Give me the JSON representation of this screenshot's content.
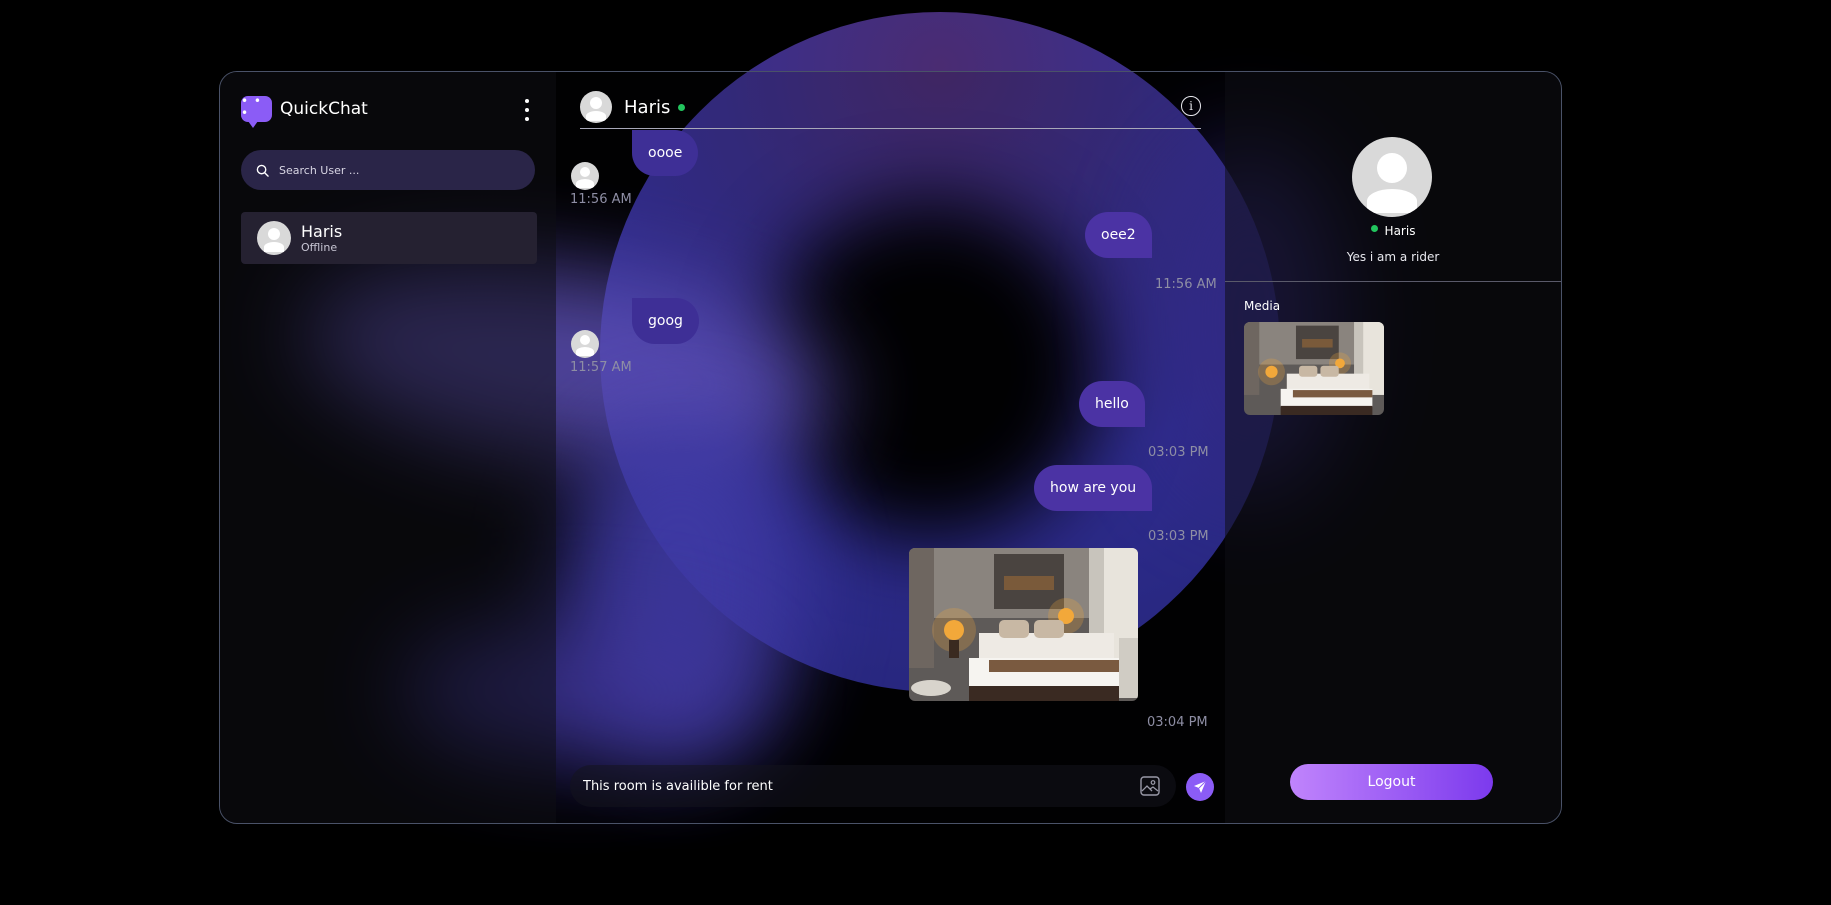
{
  "app": {
    "name": "QuickChat"
  },
  "sidebar": {
    "search_placeholder": "Search User ...",
    "contacts": [
      {
        "name": "Haris",
        "status": "Offline"
      }
    ]
  },
  "chat": {
    "header": {
      "name": "Haris"
    },
    "messages": [
      {
        "direction": "received",
        "text": "oooe",
        "time": "11:56 AM"
      },
      {
        "direction": "sent",
        "text": "oee2",
        "time": "11:56 AM"
      },
      {
        "direction": "received",
        "text": "goog",
        "time": "11:57 AM"
      },
      {
        "direction": "sent",
        "text": "hello",
        "time": "03:03 PM"
      },
      {
        "direction": "sent",
        "text": "how are you",
        "time": "03:03 PM"
      },
      {
        "direction": "sent",
        "type": "image",
        "time": "03:04 PM"
      }
    ],
    "composer_value": "This room is availible for rent "
  },
  "profile": {
    "name": "Haris",
    "bio": "Yes i am a rider",
    "media_label": "Media",
    "logout_label": "Logout"
  },
  "icons": {
    "logo": "chat-bubble-icon",
    "menu": "kebab-menu-icon",
    "search": "search-icon",
    "info": "info-icon",
    "gallery": "image-icon",
    "send": "send-icon"
  },
  "colors": {
    "accent": "#8b5cf6",
    "online": "#22c55e",
    "bubble": "#4b33a4"
  }
}
